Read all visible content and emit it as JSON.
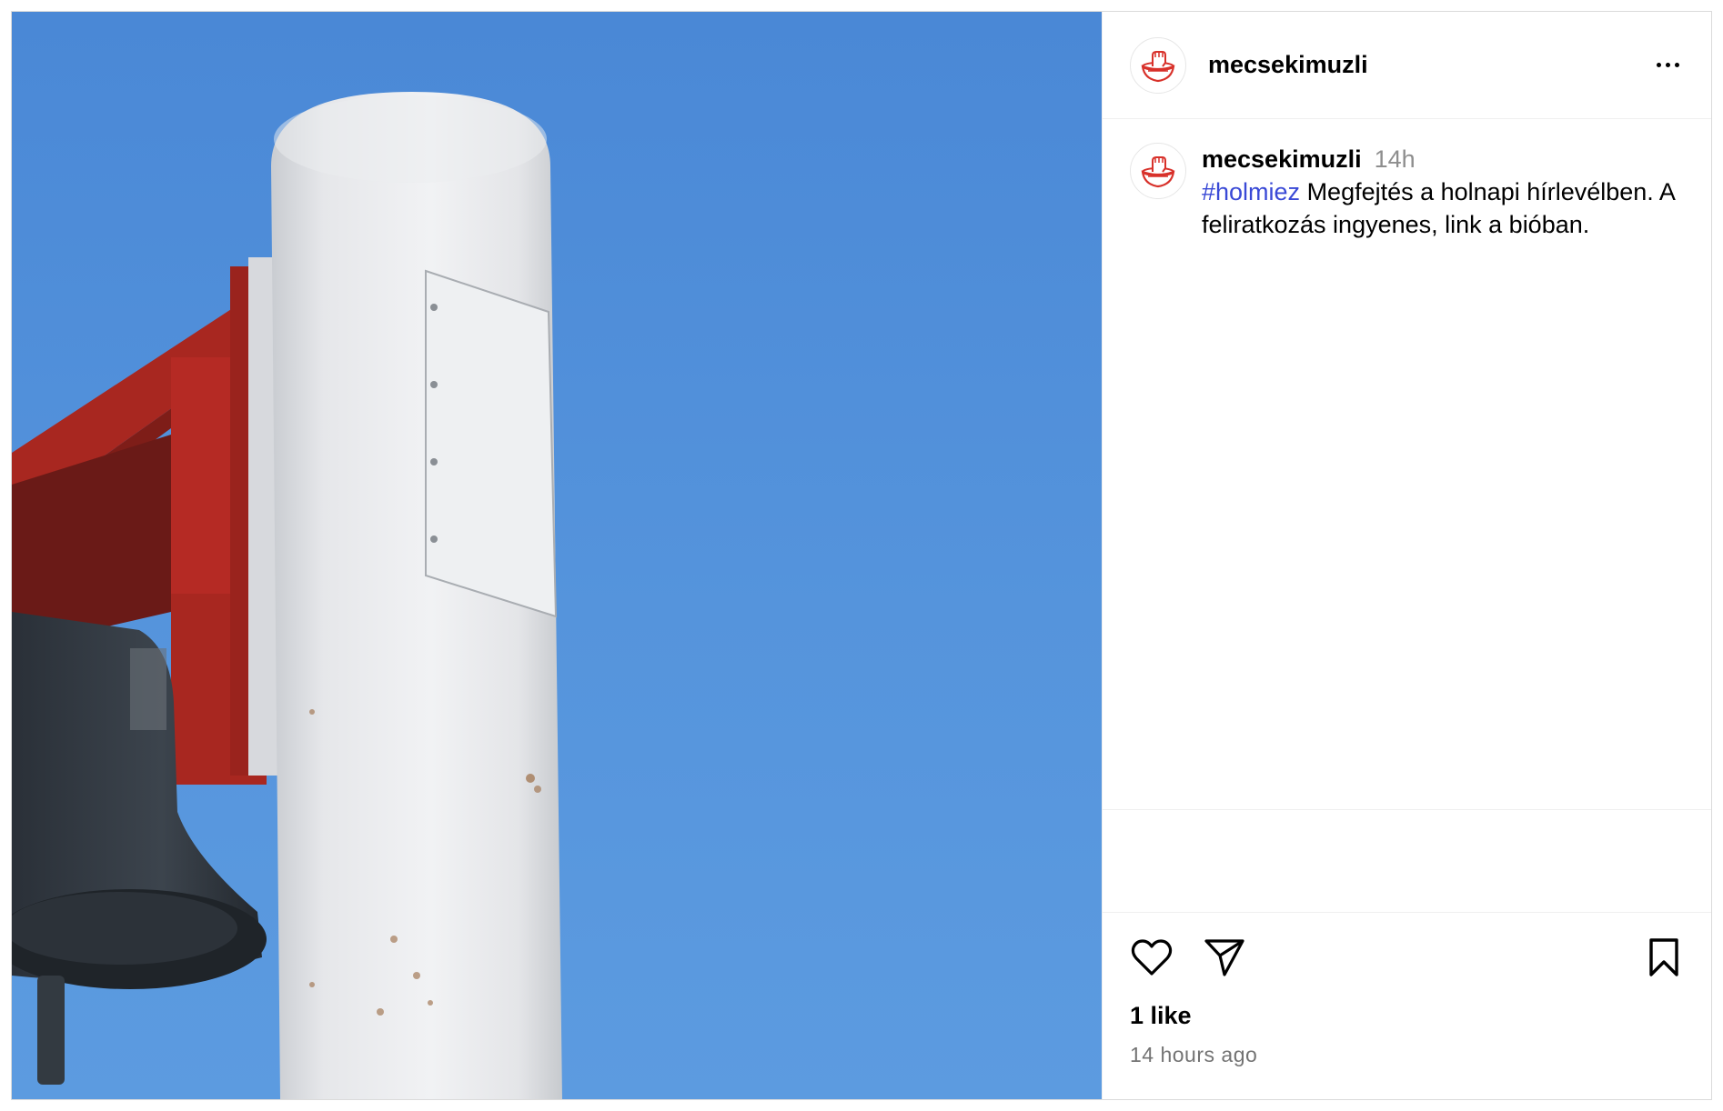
{
  "post": {
    "username": "mecsekimuzli",
    "menu_icon": "more-horizontal-icon",
    "image_alt": "White pole with red bracket and bell against blue sky"
  },
  "caption": {
    "username": "mecsekimuzli",
    "time": "14h",
    "hashtag": "#holmiez",
    "text": " Megfejtés a holnapi hírlevélben. A feliratkozás ingyenes, link a bióban."
  },
  "actions": {
    "like_icon": "heart-icon",
    "share_icon": "paper-plane-icon",
    "save_icon": "bookmark-icon",
    "likes": "1 like",
    "timestamp": "14 hours ago"
  },
  "colors": {
    "hashtag": "#3949d6",
    "sky": "#5594dc",
    "bracket_red": "#b52a24",
    "logo_red": "#d8312a"
  }
}
